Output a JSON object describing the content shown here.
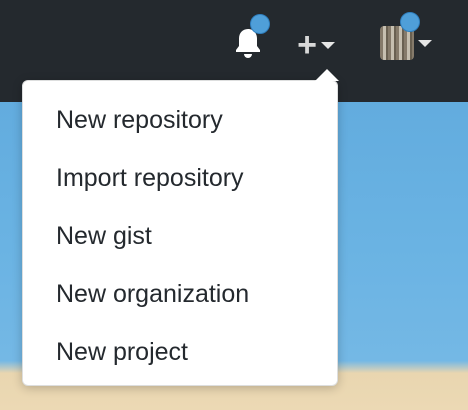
{
  "header": {
    "notifications_icon": "bell-icon",
    "create_icon": "plus-icon",
    "avatar_icon": "user-avatar",
    "badge_color": "#4f9fd9",
    "background": "#24292e"
  },
  "create_menu": {
    "items": [
      {
        "label": "New repository"
      },
      {
        "label": "Import repository"
      },
      {
        "label": "New gist"
      },
      {
        "label": "New organization"
      },
      {
        "label": "New project"
      }
    ]
  }
}
